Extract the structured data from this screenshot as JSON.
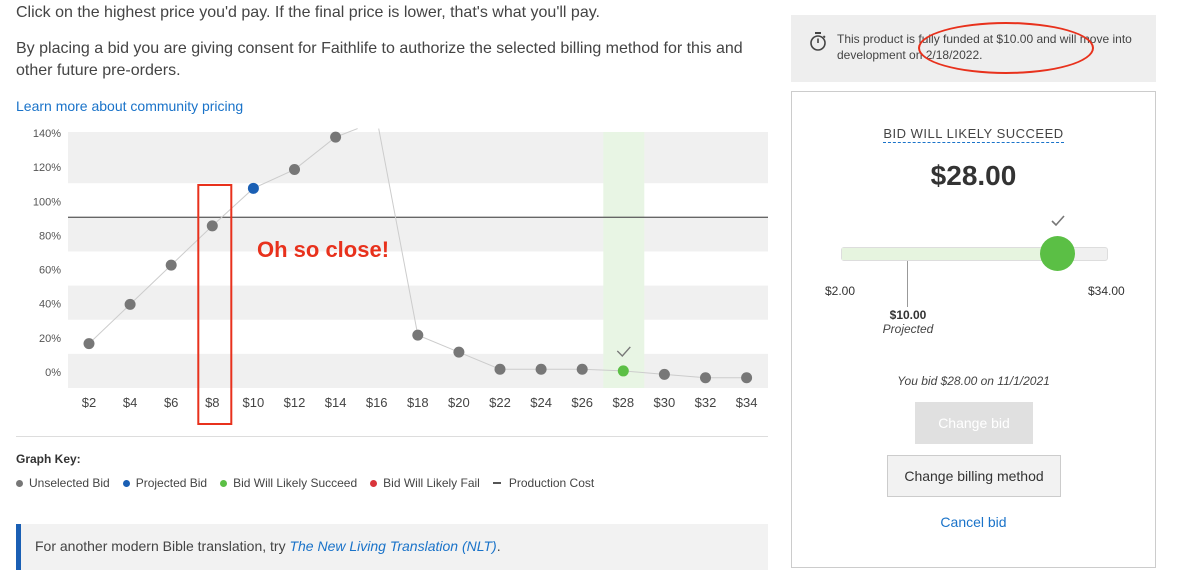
{
  "intro": {
    "line1": "Click on the highest price you'd pay. If the final price is lower, that's what you'll pay.",
    "line2": "By placing a bid you are giving consent for Faithlife to authorize the selected billing method for this and other future pre-orders.",
    "learn_more": "Learn more about community pricing"
  },
  "chart_data": {
    "type": "scatter",
    "categories": [
      "$2",
      "$4",
      "$6",
      "$8",
      "$10",
      "$12",
      "$14",
      "$16",
      "$18",
      "$20",
      "$22",
      "$24",
      "$26",
      "$28",
      "$30",
      "$32",
      "$34"
    ],
    "y_ticks": [
      "0%",
      "20%",
      "40%",
      "60%",
      "80%",
      "100%",
      "120%",
      "140%"
    ],
    "ylim": [
      0,
      150
    ],
    "production_cost_line": 100,
    "points": [
      {
        "x": "$2",
        "y": 26,
        "kind": "unselected"
      },
      {
        "x": "$4",
        "y": 49,
        "kind": "unselected"
      },
      {
        "x": "$6",
        "y": 72,
        "kind": "unselected"
      },
      {
        "x": "$8",
        "y": 95,
        "kind": "unselected"
      },
      {
        "x": "$10",
        "y": 117,
        "kind": "projected"
      },
      {
        "x": "$12",
        "y": 128,
        "kind": "unselected"
      },
      {
        "x": "$14",
        "y": 147,
        "kind": "unselected"
      },
      {
        "x": "$18",
        "y": 31,
        "kind": "unselected"
      },
      {
        "x": "$20",
        "y": 21,
        "kind": "unselected"
      },
      {
        "x": "$22",
        "y": 11,
        "kind": "unselected"
      },
      {
        "x": "$24",
        "y": 11,
        "kind": "unselected"
      },
      {
        "x": "$26",
        "y": 11,
        "kind": "unselected"
      },
      {
        "x": "$28",
        "y": 10,
        "kind": "selected"
      },
      {
        "x": "$30",
        "y": 8,
        "kind": "unselected"
      },
      {
        "x": "$32",
        "y": 6,
        "kind": "unselected"
      },
      {
        "x": "$34",
        "y": 6,
        "kind": "unselected"
      }
    ],
    "selected_category": "$28",
    "annotation": "Oh so close!",
    "annotation_category": "$8"
  },
  "graph_key": {
    "title": "Graph Key:",
    "items": [
      {
        "label": "Unselected Bid",
        "color": "#777777",
        "shape": "dot"
      },
      {
        "label": "Projected Bid",
        "color": "#1a5fb4",
        "shape": "dot"
      },
      {
        "label": "Bid Will Likely Succeed",
        "color": "#5bbf45",
        "shape": "dot"
      },
      {
        "label": "Bid Will Likely Fail",
        "color": "#d9343a",
        "shape": "dot"
      },
      {
        "label": "Production Cost",
        "color": "#555555",
        "shape": "dash"
      }
    ]
  },
  "note": {
    "prefix": "For another modern Bible translation, try ",
    "link": "The New Living Translation (NLT)",
    "suffix": "."
  },
  "funded": {
    "text": "This product is fully funded at $10.00 and will move into development on 2/18/2022."
  },
  "bid": {
    "status": "BID WILL LIKELY SUCCEED",
    "amount": "$28.00",
    "fill_fraction": 0.8125,
    "min": "$2.00",
    "max": "$34.00",
    "projected_amount": "$10.00",
    "projected_label": "Projected",
    "your_bid": "You bid $28.00 on 11/1/2021",
    "change_bid": "Change bid",
    "change_billing": "Change billing method",
    "cancel": "Cancel bid"
  },
  "colors": {
    "link": "#1a73c9",
    "success": "#5bbf45",
    "projected": "#1a5fb4",
    "annotation": "#e8311c"
  }
}
